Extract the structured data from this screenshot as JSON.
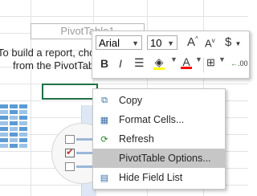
{
  "pivot": {
    "name": "PivotTable1",
    "hint_line1": "To build a report, cho",
    "hint_line2": "from the PivotTable"
  },
  "mini_toolbar": {
    "font": "Arial",
    "size": "10",
    "grow_font_label": "A",
    "shrink_font_label": "A",
    "currency_label": "$",
    "bold_label": "B",
    "italic_label": "I",
    "font_color_label": "A",
    "decimals_label": ".00",
    "fill_color": "#ffff00",
    "font_color": "#ff0000"
  },
  "context_menu": {
    "items": [
      {
        "label": "Copy",
        "icon": "copy-icon"
      },
      {
        "label": "Format Cells...",
        "icon": "format-cells-icon"
      },
      {
        "label": "Refresh",
        "icon": "refresh-icon"
      },
      {
        "label": "PivotTable Options...",
        "icon": "none",
        "highlighted": true
      },
      {
        "label": "Hide Field List",
        "icon": "field-list-icon"
      }
    ]
  }
}
